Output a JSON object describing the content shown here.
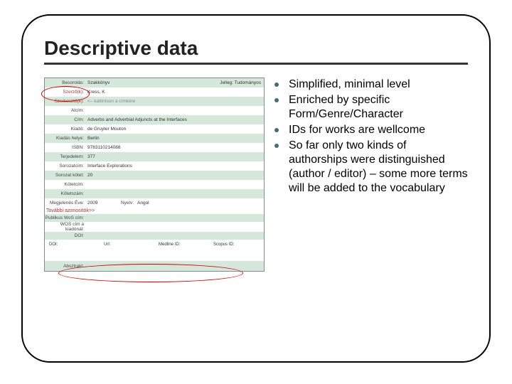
{
  "title": "Descriptive data",
  "form": {
    "rows": [
      {
        "label": "Besorolás:",
        "value": "Szakkönyv",
        "extra": "Jelleg: Tudományos"
      },
      {
        "label": "Szerző(k):",
        "value": "Kress, K"
      },
      {
        "label": "Szerkesztő(k):",
        "value": "<– kattintson a címkére"
      },
      {
        "label": "Alcím:",
        "value": ""
      },
      {
        "label": "Cím:",
        "value": "Adverbs and Adverbial Adjuncts at the Interfaces"
      },
      {
        "label": "Kiadó:",
        "value": "de Gruyter Mouton"
      },
      {
        "label": "Kiadás helye:",
        "value": "Berlin"
      },
      {
        "label": "ISBN:",
        "value": "9783110214088"
      },
      {
        "label": "Terjedelem:",
        "value": "377"
      },
      {
        "label": "Sorozatcím:",
        "value": "Interface Explorations"
      },
      {
        "label": "Sorozat kötet:",
        "value": "20"
      },
      {
        "label": "Kötetcím:",
        "value": ""
      },
      {
        "label": "Kötetszám:",
        "value": ""
      }
    ],
    "year_label": "Megjelenés Éve:",
    "year_value": "2009",
    "lang_label": "Nyelv:",
    "lang_value": "Angol",
    "more_ids": "További azonosítók>>",
    "grid_labels": [
      "Publikus WoS cím:",
      "WOS cím a kiadónál:",
      "DOI:",
      "Url:",
      "Medline ID:",
      "Scopus ID:"
    ],
    "abstract": "Absztrakt:"
  },
  "bullets": [
    "Simplified, minimal level",
    "Enriched by specific Form/Genre/Character",
    "IDs for works are wellcome",
    "So far only two kinds of authorships were distinguished (author / editor) – some more terms will be added to the vocabulary"
  ]
}
